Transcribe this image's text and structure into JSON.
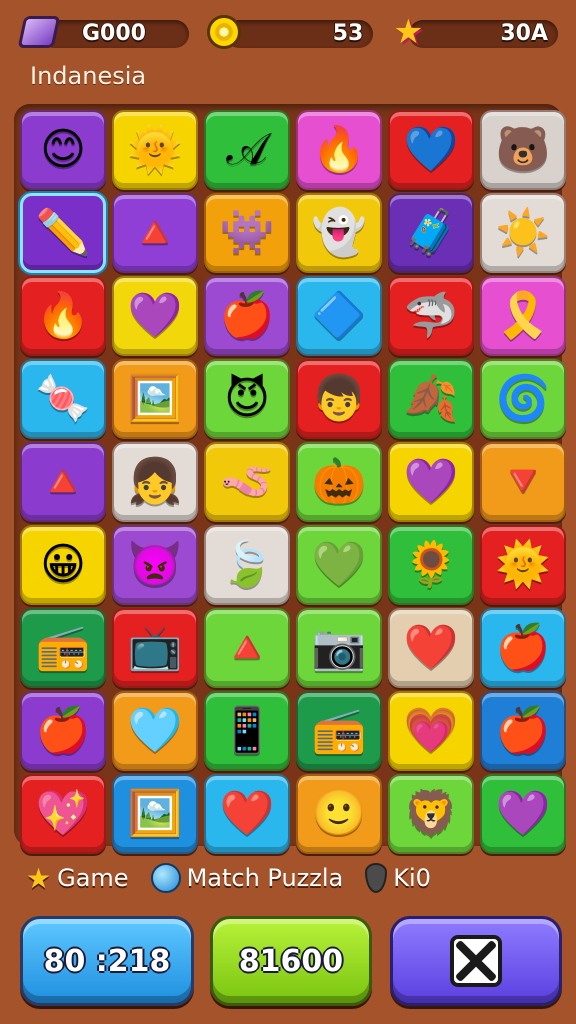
{
  "hud": {
    "gems": {
      "value": "G000",
      "icon": "gem-icon"
    },
    "coins": {
      "value": "53",
      "icon": "coin-icon"
    },
    "stars": {
      "value": "30A",
      "icon": "star-icon"
    }
  },
  "region_label": "Indanesia",
  "board": {
    "rows": [
      [
        {
          "icon": "boy-face-icon",
          "glyph": "😊",
          "color": "#8b3ccf"
        },
        {
          "icon": "sun-icon",
          "glyph": "🌞",
          "color": "#f5d400"
        },
        {
          "icon": "swirl-icon",
          "glyph": "𝒜",
          "color": "#2fbf3a"
        },
        {
          "icon": "flame-face-icon",
          "glyph": "🔥",
          "color": "#e54fd0"
        },
        {
          "icon": "heart-icon",
          "glyph": "💙",
          "color": "#e52020"
        },
        {
          "icon": "bear-face-icon",
          "glyph": "🐻",
          "color": "#d9d2cc"
        }
      ],
      [
        {
          "icon": "pencil-icon",
          "glyph": "✏️",
          "color": "#7a2fc8",
          "selected": true
        },
        {
          "icon": "cone-face-icon",
          "glyph": "🔺",
          "color": "#8f3fd6"
        },
        {
          "icon": "monster-icon",
          "glyph": "👾",
          "color": "#f2a10a"
        },
        {
          "icon": "blob-face-icon",
          "glyph": "👻",
          "color": "#f2c80a"
        },
        {
          "icon": "suitcase-icon",
          "glyph": "🧳",
          "color": "#6a2fb5"
        },
        {
          "icon": "sun-icon",
          "glyph": "☀️",
          "color": "#e3dcd6"
        }
      ],
      [
        {
          "icon": "flame-icon",
          "glyph": "🔥",
          "color": "#e52020"
        },
        {
          "icon": "heart-icon",
          "glyph": "💜",
          "color": "#f2d80a"
        },
        {
          "icon": "apple-icon",
          "glyph": "🍎",
          "color": "#9b4ad1"
        },
        {
          "icon": "cone-face-icon",
          "glyph": "🔷",
          "color": "#29b7ee"
        },
        {
          "icon": "shark-icon",
          "glyph": "🦈",
          "color": "#e52020"
        },
        {
          "icon": "ribbon-icon",
          "glyph": "🎗️",
          "color": "#e54fd0"
        }
      ],
      [
        {
          "icon": "candy-icon",
          "glyph": "🍬",
          "color": "#29b7ee"
        },
        {
          "icon": "frame-icon",
          "glyph": "🖼️",
          "color": "#f29a1a"
        },
        {
          "icon": "blob-face-icon",
          "glyph": "😈",
          "color": "#6cd63a"
        },
        {
          "icon": "boy-face-icon",
          "glyph": "👦",
          "color": "#e52020"
        },
        {
          "icon": "leaf-icon",
          "glyph": "🍂",
          "color": "#2fbf3a"
        },
        {
          "icon": "swirl-ball-icon",
          "glyph": "🌀",
          "color": "#6cd63a"
        }
      ],
      [
        {
          "icon": "cone-face-icon",
          "glyph": "🔺",
          "color": "#8b3ccf"
        },
        {
          "icon": "boy-face-icon",
          "glyph": "👧",
          "color": "#e3dcd6"
        },
        {
          "icon": "worm-icon",
          "glyph": "🪱",
          "color": "#f2c80a"
        },
        {
          "icon": "pumpkin-icon",
          "glyph": "🎃",
          "color": "#6cd63a"
        },
        {
          "icon": "heart-icon",
          "glyph": "💜",
          "color": "#f5d400"
        },
        {
          "icon": "cone-face-icon",
          "glyph": "🔻",
          "color": "#f29a1a"
        }
      ],
      [
        {
          "icon": "boy-face-icon",
          "glyph": "😀",
          "color": "#f5d400"
        },
        {
          "icon": "spiky-face-icon",
          "glyph": "👿",
          "color": "#9b4ad1"
        },
        {
          "icon": "leaf-icon",
          "glyph": "🍃",
          "color": "#e3dcd6"
        },
        {
          "icon": "heart-icon",
          "glyph": "💚",
          "color": "#6cd63a"
        },
        {
          "icon": "sun-face-icon",
          "glyph": "🌻",
          "color": "#2fbf3a"
        },
        {
          "icon": "sun-icon",
          "glyph": "🌞",
          "color": "#e52020"
        }
      ],
      [
        {
          "icon": "radio-icon",
          "glyph": "📻",
          "color": "#1e9b4a"
        },
        {
          "icon": "tv-icon",
          "glyph": "📺",
          "color": "#e52020"
        },
        {
          "icon": "cone-face-icon",
          "glyph": "🔺",
          "color": "#6cd63a"
        },
        {
          "icon": "camera-icon",
          "glyph": "📷",
          "color": "#6cd63a"
        },
        {
          "icon": "heart-icon",
          "glyph": "❤️",
          "color": "#e3cfb0"
        },
        {
          "icon": "apple-icon",
          "glyph": "🍎",
          "color": "#29b7ee"
        }
      ],
      [
        {
          "icon": "apple-icon",
          "glyph": "🍎",
          "color": "#8b3ccf"
        },
        {
          "icon": "heart-icon",
          "glyph": "🩵",
          "color": "#f29a1a"
        },
        {
          "icon": "phone-icon",
          "glyph": "📱",
          "color": "#2fbf3a"
        },
        {
          "icon": "radio-icon",
          "glyph": "📻",
          "color": "#1e9b4a"
        },
        {
          "icon": "sun-heart-icon",
          "glyph": "💗",
          "color": "#f5d400"
        },
        {
          "icon": "apple-icon",
          "glyph": "🍎",
          "color": "#1f7fd6"
        }
      ],
      [
        {
          "icon": "heart-icon",
          "glyph": "💖",
          "color": "#e52020"
        },
        {
          "icon": "frame-icon",
          "glyph": "🖼️",
          "color": "#1f8fe0"
        },
        {
          "icon": "heart-icon",
          "glyph": "❤️",
          "color": "#29b7ee"
        },
        {
          "icon": "boy-face-icon",
          "glyph": "🙂",
          "color": "#f29a1a"
        },
        {
          "icon": "lion-face-icon",
          "glyph": "🦁",
          "color": "#6cd63a"
        },
        {
          "icon": "sun-heart-icon",
          "glyph": "💜",
          "color": "#2fbf3a"
        }
      ]
    ]
  },
  "legend": [
    {
      "icon": "star-icon",
      "glyph": "⭐",
      "label": "Game"
    },
    {
      "icon": "blue-orb-icon",
      "glyph": "",
      "label": "Match Puzzla"
    },
    {
      "icon": "drop-icon",
      "glyph": "",
      "label": "Ki0"
    }
  ],
  "buttons": {
    "timer": "80 :218",
    "score": "81600",
    "close_icon": "close-icon"
  }
}
